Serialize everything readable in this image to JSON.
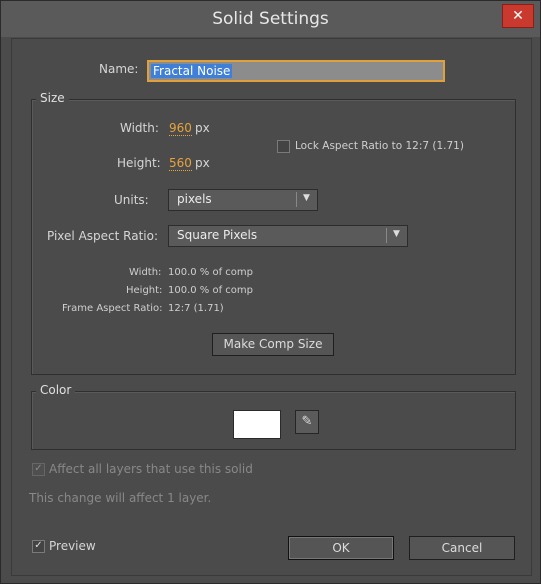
{
  "window": {
    "title": "Solid Settings",
    "close_glyph": "✕"
  },
  "name": {
    "label": "Name:",
    "value": "Fractal Noise"
  },
  "size": {
    "legend": "Size",
    "width_label": "Width:",
    "width_value": "960",
    "width_unit": "px",
    "height_label": "Height:",
    "height_value": "560",
    "height_unit": "px",
    "lock_aspect_label": "Lock Aspect Ratio to 12:7 (1.71)",
    "lock_aspect_checked": false,
    "units_label": "Units:",
    "units_value": "pixels",
    "par_label": "Pixel Aspect Ratio:",
    "par_value": "Square Pixels",
    "info_width_label": "Width:",
    "info_width_value": "100.0 % of comp",
    "info_height_label": "Height:",
    "info_height_value": "100.0 % of comp",
    "info_far_label": "Frame Aspect Ratio:",
    "info_far_value": "12:7 (1.71)",
    "make_comp_size_label": "Make Comp Size"
  },
  "color": {
    "legend": "Color",
    "swatch_color": "#ffffff",
    "eyedropper_icon": "eyedropper-icon"
  },
  "affect": {
    "label": "Affect all layers that use this solid",
    "checked": true,
    "note": "This change will affect 1 layer."
  },
  "footer": {
    "preview_label": "Preview",
    "preview_checked": true,
    "ok_label": "OK",
    "cancel_label": "Cancel"
  },
  "colors": {
    "accent": "#e8a33a",
    "selection": "#3f7fd6",
    "close": "#c9392e"
  }
}
